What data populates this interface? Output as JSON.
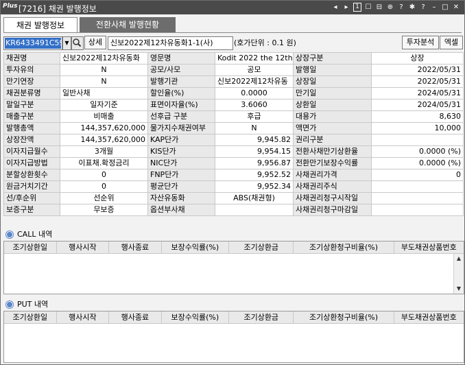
{
  "window": {
    "logo": "Plus",
    "title": "[7216] 채권 발행정보",
    "controls": [
      "◂",
      "▸",
      "1",
      "☐",
      "⊟",
      "⊕",
      "?",
      "✱",
      "?",
      "–",
      "□",
      "✕"
    ]
  },
  "tabs": [
    {
      "label": "채권 발행정보"
    },
    {
      "label": "전환사채 발행현황"
    }
  ],
  "toolbar": {
    "code_value": "KR6433491C59",
    "detail_label": "상세",
    "bond_name": "신보2022제12차유동화1-1(사)",
    "unit_text": "(호가단위 : 0.1   원)",
    "analysis_label": "투자분석",
    "excel_label": "엑셀"
  },
  "info_rows": [
    [
      "채권명",
      "신보2022제12차유동화",
      "영문명",
      "Kodit 2022 the 12th",
      "상장구분",
      "상장"
    ],
    [
      "투자유의",
      "N",
      "공모/사모",
      "공모",
      "발행일",
      "2022/05/31"
    ],
    [
      "만기연장",
      "N",
      "발행기관",
      "신보2022제12차유동",
      "상장일",
      "2022/05/31"
    ],
    [
      "채권분류명",
      "일반사채",
      "할인율(%)",
      "0.0000",
      "만기일",
      "2024/05/31"
    ],
    [
      "말일구분",
      "일자기준",
      "표면이자율(%)",
      "3.6060",
      "상환일",
      "2024/05/31"
    ],
    [
      "매출구분",
      "비매출",
      "선후급 구분",
      "후급",
      "대용가",
      "8,630"
    ],
    [
      "발행총액",
      "144,357,620,000",
      "물가지수채권여부",
      "N",
      "액면가",
      "10,000"
    ],
    [
      "상장잔액",
      "144,357,620,000",
      "KAP단가",
      "9,945.82",
      "권리구분",
      ""
    ],
    [
      "이자지급월수",
      "3개월",
      "KIS단가",
      "9,954.15",
      "전환사채만기상환율",
      "0.0000 (%)"
    ],
    [
      "이자지급방법",
      "이표채.확정금리",
      "NIC단가",
      "9,956.87",
      "전환만기보장수익률",
      "0.0000 (%)"
    ],
    [
      "분할상환횟수",
      "0",
      "FNP단가",
      "9,952.52",
      "사채권리가격",
      "0"
    ],
    [
      "원금거치기간",
      "0",
      "평균단가",
      "9,952.34",
      "사채권리주식",
      ""
    ],
    [
      "선/후순위",
      "선순위",
      "자산유동화",
      "ABS(채권형)",
      "사채권리청구시작일",
      ""
    ],
    [
      "보증구분",
      "무보증",
      "옵션부사채",
      "",
      "사채권리청구마감일",
      ""
    ]
  ],
  "call_section": {
    "title": "CALL 내역",
    "columns": [
      "조기상환일",
      "행사시작",
      "행사종료",
      "보장수익률(%)",
      "조기상환금",
      "조기상환청구비율(%)",
      "부도채권상품번호"
    ]
  },
  "put_section": {
    "title": "PUT 내역",
    "columns": [
      "조기상환일",
      "행사시작",
      "행사종료",
      "보장수익률(%)",
      "조기상환금",
      "조기상환청구비율(%)",
      "부도채권상품번호"
    ]
  }
}
